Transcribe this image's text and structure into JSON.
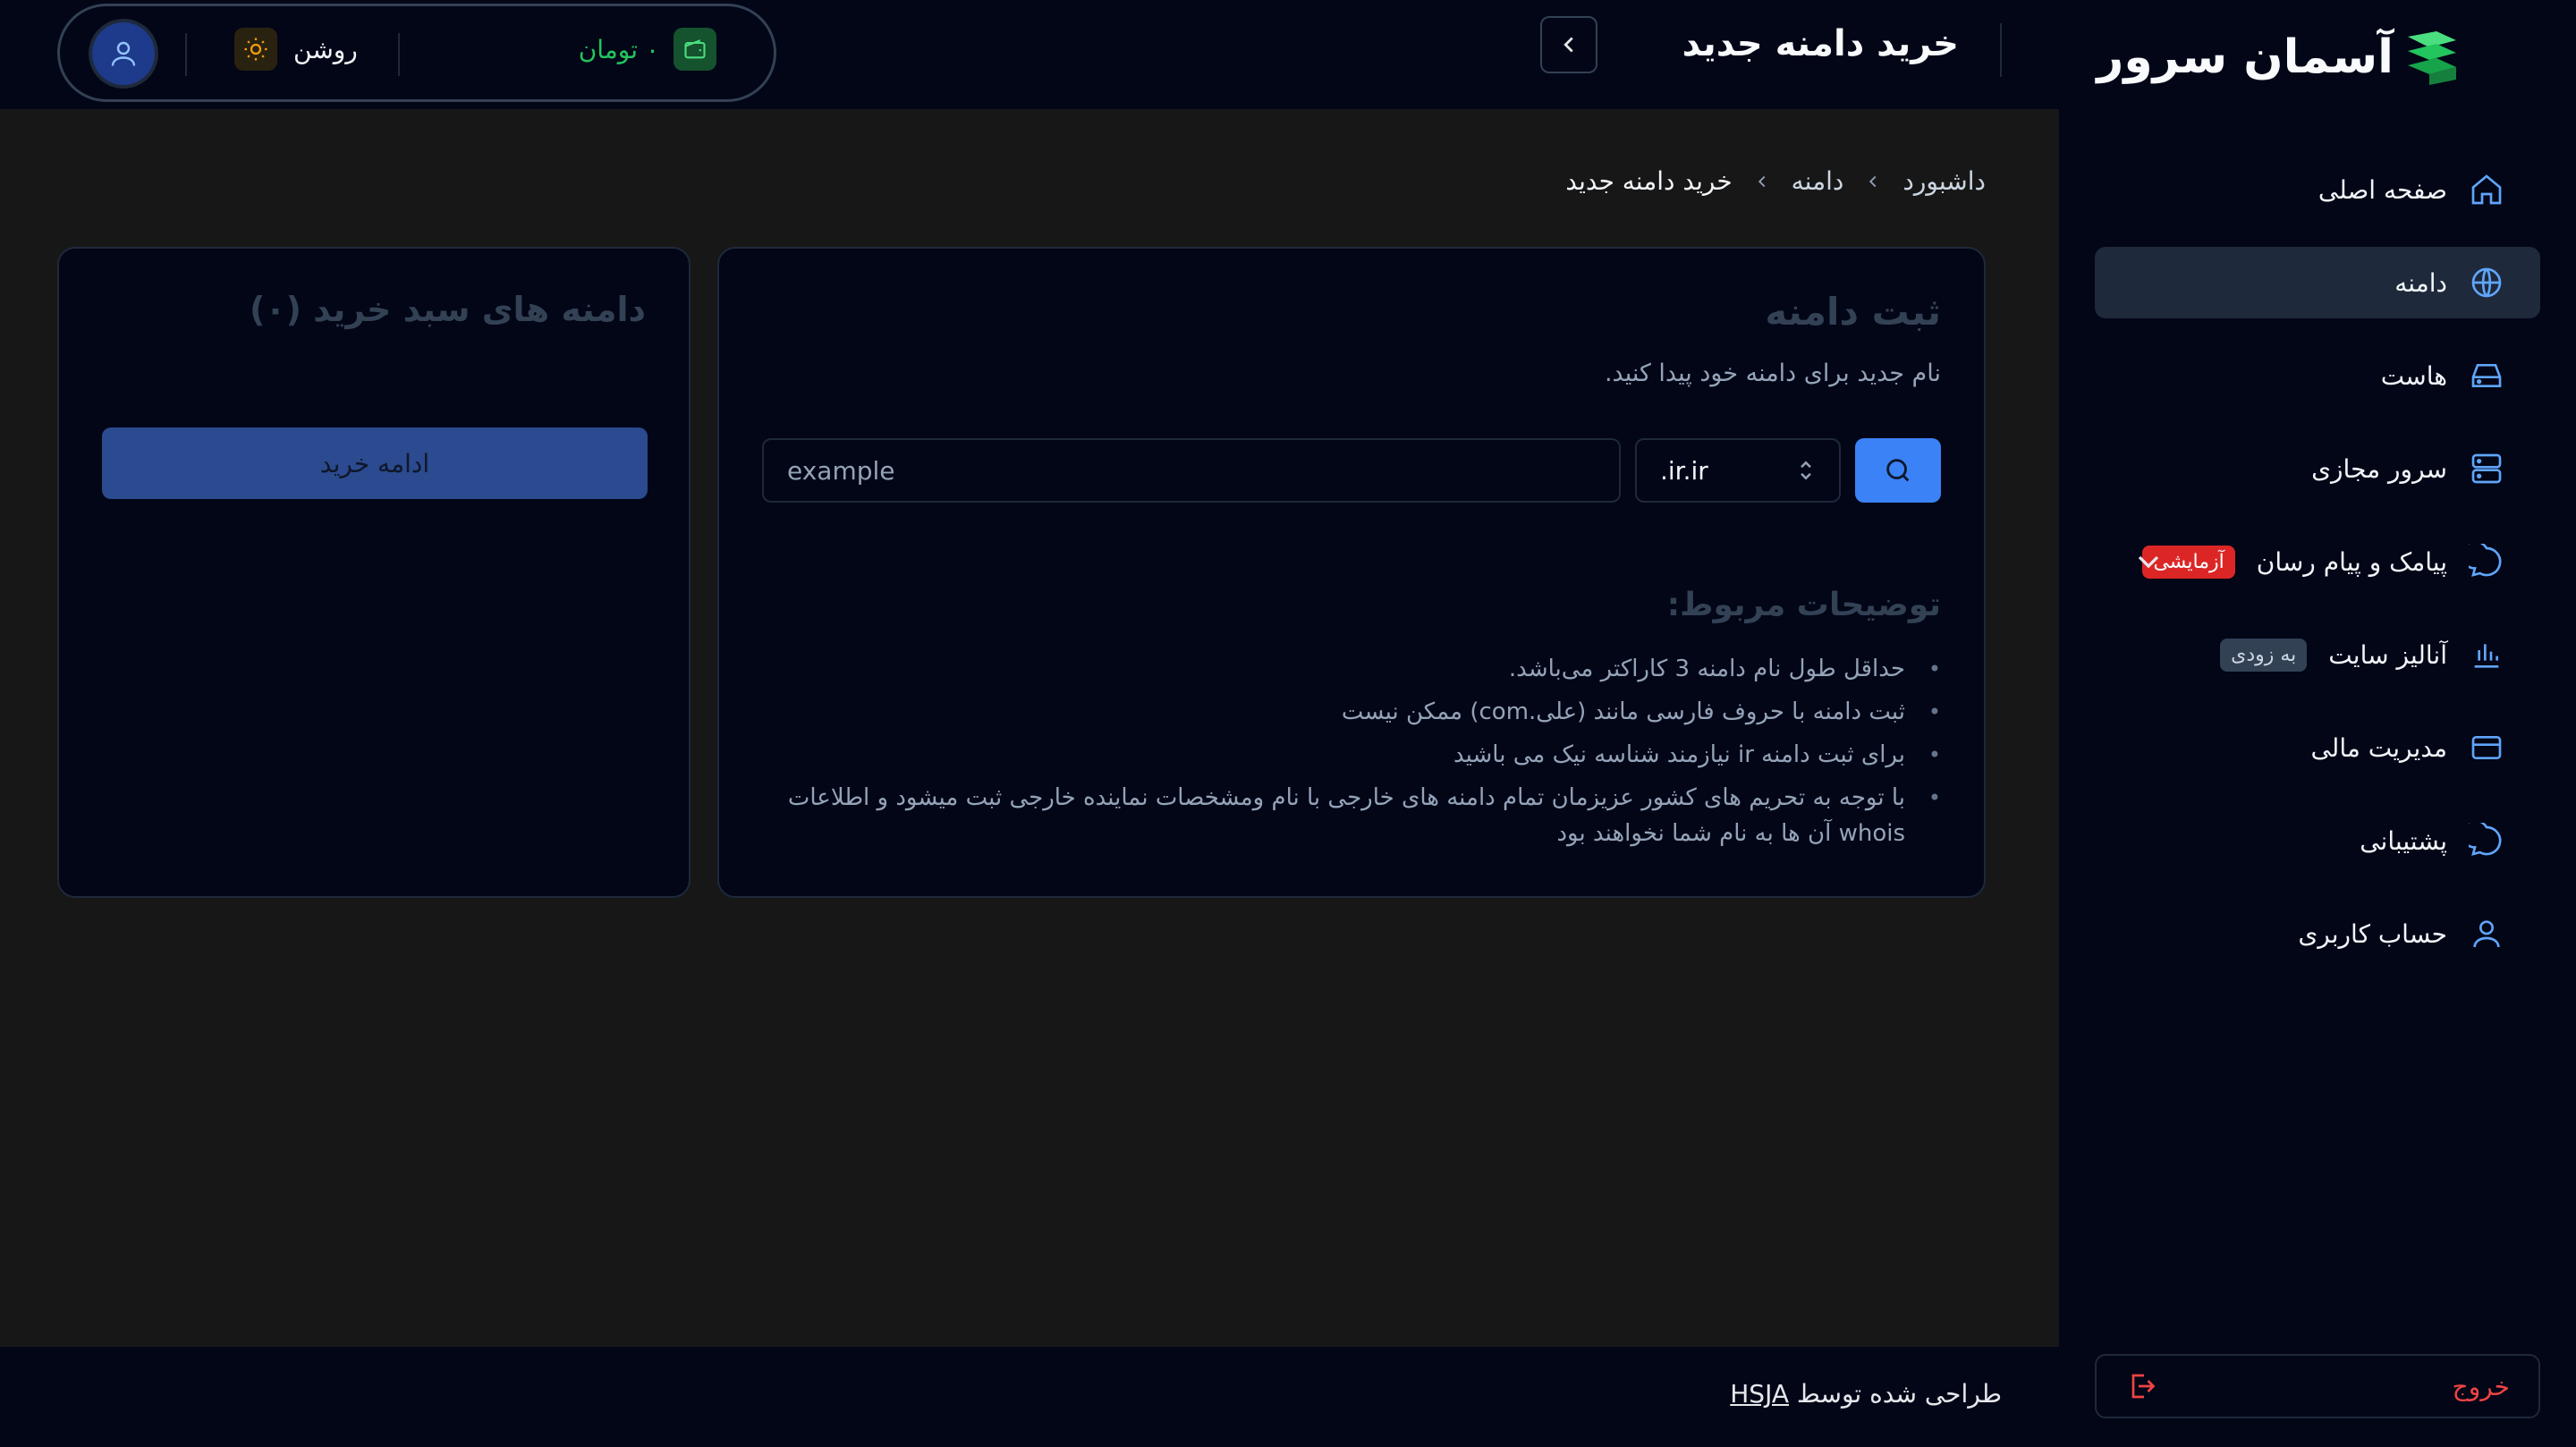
{
  "brand": {
    "name": "آسمان سرور"
  },
  "header": {
    "title": "خرید دامنه جدید",
    "balance": "۰ تومان",
    "theme_label": "روشن"
  },
  "sidebar": {
    "items": [
      {
        "label": "صفحه اصلی",
        "icon": "home-icon"
      },
      {
        "label": "دامنه",
        "icon": "globe-icon",
        "active": true
      },
      {
        "label": "هاست",
        "icon": "hard-drive-icon"
      },
      {
        "label": "سرور مجازی",
        "icon": "server-icon"
      },
      {
        "label": "پیامک و پیام رسان",
        "icon": "chat-icon",
        "badge": "آزمایشی"
      },
      {
        "label": "آنالیز سایت",
        "icon": "bar-chart-icon",
        "badge": "به زودی"
      },
      {
        "label": "مدیریت مالی",
        "icon": "credit-card-icon"
      },
      {
        "label": "پشتیبانی",
        "icon": "support-chat-icon"
      },
      {
        "label": "حساب کاربری",
        "icon": "user-icon"
      }
    ],
    "logout_label": "خروج"
  },
  "breadcrumb": [
    "داشبورد",
    "دامنه",
    "خرید دامنه جدید"
  ],
  "register": {
    "title": "ثبت دامنه",
    "subtitle": "نام جدید برای دامنه خود پیدا کنید.",
    "input_placeholder": "example",
    "tld_selected": ".ir.ir",
    "notes_title": "توضیحات مربوط:",
    "notes": [
      "حداقل طول نام دامنه 3 کاراکتر می‌باشد.",
      "ثبت دامنه با حروف فارسی مانند (علی.com) ممکن نیست",
      "برای ثبت دامنه ir نیازمند شناسه نیک می باشید",
      "با توجه به تحریم های کشور عزیزمان تمام دامنه های خارجی با نام ومشخصات نماینده خارجی ثبت میشود و اطلاعات whois آن ها به نام شما نخواهند بود"
    ]
  },
  "cart": {
    "title": "دامنه های سبد خرید (۰)",
    "continue_label": "ادامه خرید"
  },
  "footer": {
    "prefix": "طراحی شده توسط ",
    "author": "HSJA"
  },
  "colors": {
    "accent": "#3b82f6",
    "background": "#171717",
    "panel": "#020617",
    "danger": "#ef4444",
    "success": "#22c55e"
  }
}
